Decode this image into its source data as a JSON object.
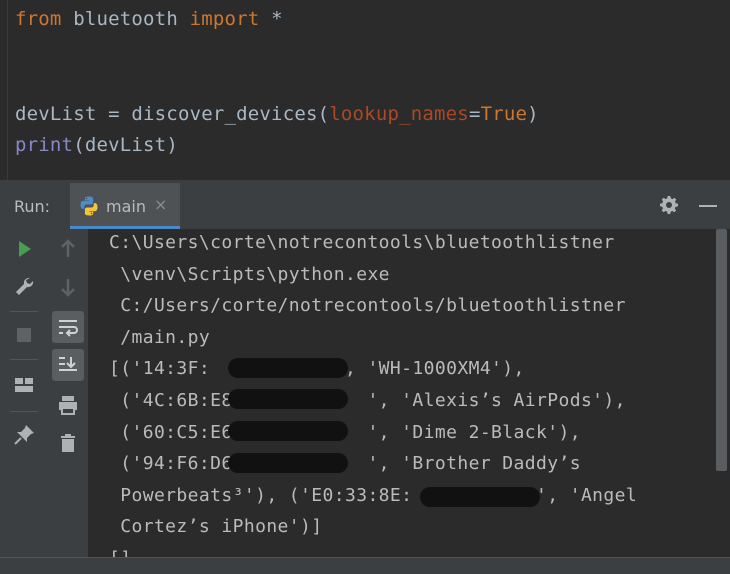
{
  "editor": {
    "lines": [
      {
        "parts": [
          {
            "t": "from",
            "c": "kw"
          },
          {
            "t": " bluetooth ",
            "c": "ident"
          },
          {
            "t": "import",
            "c": "kw"
          },
          {
            "t": " *",
            "c": "ident"
          }
        ]
      },
      {
        "parts": []
      },
      {
        "parts": []
      },
      {
        "parts": [
          {
            "t": "devList = discover_devices(",
            "c": "ident"
          },
          {
            "t": "lookup_names",
            "c": "param"
          },
          {
            "t": "=",
            "c": "ident"
          },
          {
            "t": "True",
            "c": "kw"
          },
          {
            "t": ")",
            "c": "ident"
          }
        ]
      },
      {
        "parts": [
          {
            "t": "print",
            "c": "builtin"
          },
          {
            "t": "(devList)",
            "c": "ident"
          }
        ]
      }
    ]
  },
  "run": {
    "label": "Run:",
    "tab_label": "main",
    "tab_close": "×"
  },
  "console": {
    "lines": [
      "C:\\Users\\corte\\notrecontools\\bluetoothlistner",
      " \\venv\\Scripts\\python.exe",
      " C:/Users/corte/notrecontools/bluetoothlistner",
      " /main.py",
      "[('14:3F:           ', 'WH-1000XM4'),",
      " ('4C:6B:E8:           ', 'Alexis’s AirPods'),",
      " ('60:C5:E6:           ', 'Dime 2-Black'),",
      " ('94:F6:D6:           ', 'Brother Daddy’s",
      " Powerbeats³'), ('E0:33:8E:           ', 'Angel",
      " Cortez’s iPhone')]",
      "[]"
    ]
  },
  "colors": {
    "keyword": "#cc7832",
    "param": "#aa4926",
    "builtin": "#8888c6",
    "text": "#a9b7c6",
    "run_icon": "#499c54",
    "tab_accent": "#4a88c7"
  }
}
